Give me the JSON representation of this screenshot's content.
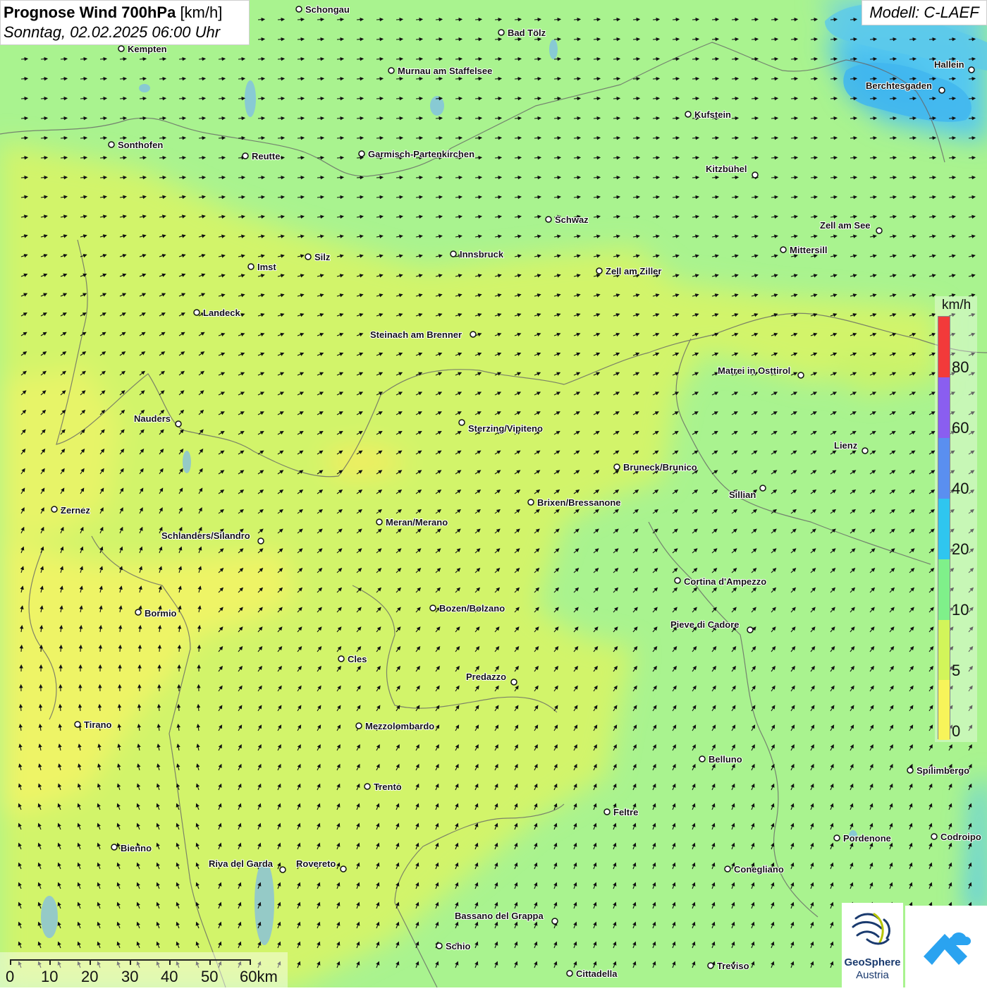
{
  "title": {
    "bold": "Prognose Wind 700hPa",
    "unit": "[km/h]",
    "date": "Sonntag, 02.02.2025 06:00 Uhr"
  },
  "model": "Modell: C-LAEF",
  "legend": {
    "unit": "km/h",
    "ticks": [
      "0",
      "5",
      "10",
      "20",
      "40",
      "60",
      "80"
    ],
    "colors": [
      "#f7f45a",
      "#d2f55a",
      "#7ff08a",
      "#2fc6ef",
      "#5a8ff0",
      "#8a5ef0",
      "#f23a3a"
    ]
  },
  "scalebar": {
    "labels": [
      "0",
      "10",
      "20",
      "30",
      "40",
      "50",
      "60km"
    ]
  },
  "logos": {
    "geosphere_line1": "GeoSphere",
    "geosphere_line2": "Austria"
  },
  "cities": [
    "Schongau",
    "Bad Tölz",
    "Kempten",
    "Murnau am Staffelsee",
    "Hallein",
    "Berchtesgaden",
    "Kufstein",
    "Sonthofen",
    "Reutte",
    "Garmisch-Partenkirchen",
    "Kitzbühel",
    "Schwaz",
    "Zell am See",
    "Mittersill",
    "Silz",
    "Innsbruck",
    "Imst",
    "Zell am Ziller",
    "Landeck",
    "Steinach am Brenner",
    "Matrei in Osttirol",
    "Nauders",
    "Sterzing/Vipiteno",
    "Lienz",
    "Bruneck/Brunico",
    "Sillian",
    "Zernez",
    "Brixen/Bressanone",
    "Meran/Merano",
    "Schlanders/Silandro",
    "Cortina d'Ampezzo",
    "Bozen/Bolzano",
    "Bormio",
    "Pieve di Cadore",
    "Cles",
    "Predazzo",
    "Tirano",
    "Mezzolombardo",
    "Belluno",
    "Spilimbergo",
    "Trento",
    "Feltre",
    "Pordenone",
    "Codroipo",
    "Bienno",
    "Riva del Garda",
    "Rovereto",
    "Conegliano",
    "Bassano del Grappa",
    "Schio",
    "Treviso",
    "Cittadella"
  ]
}
